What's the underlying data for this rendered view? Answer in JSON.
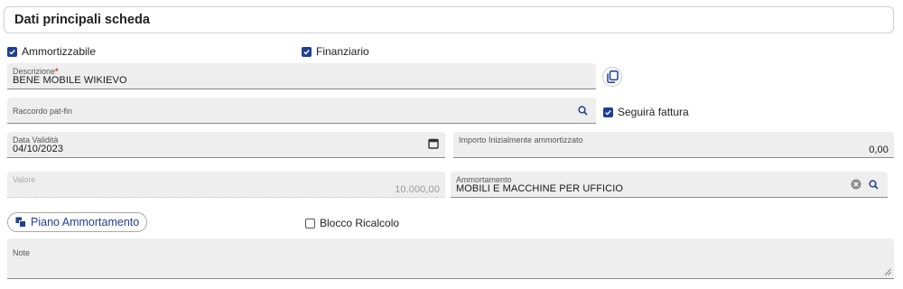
{
  "header": {
    "title": "Dati principali scheda"
  },
  "checkboxes": {
    "ammortizzabile": {
      "label": "Ammortizzabile",
      "checked": true
    },
    "finanziario": {
      "label": "Finanziario",
      "checked": true
    },
    "seguira_fattura": {
      "label": "Seguirà fattura",
      "checked": true
    },
    "blocco_ricalcolo": {
      "label": "Blocco Ricalcolo",
      "checked": false
    }
  },
  "fields": {
    "descrizione": {
      "label": "Descrizione",
      "required_mark": "*",
      "value": "BENE MOBILE WIKIEVO"
    },
    "raccordo": {
      "label": "Raccordo pat-fin",
      "value": ""
    },
    "data_validita": {
      "label": "Data Validità",
      "value": "04/10/2023"
    },
    "importo": {
      "label": "Importo Inizialmente ammortizzato",
      "value": "0,00"
    },
    "valore": {
      "label": "Valore",
      "value": "10.000,00"
    },
    "ammortamento": {
      "label": "Ammortamento",
      "value": "MOBILI E MACCHINE PER UFFICIO"
    },
    "note": {
      "label": "Note",
      "value": ""
    }
  },
  "buttons": {
    "piano_ammortamento": "Piano Ammortamento"
  },
  "icons": {
    "copy": "copy-icon",
    "search": "search-icon",
    "calendar": "calendar-icon",
    "clear": "clear-icon",
    "schedule": "schedule-icon",
    "resize": "resize-grip-icon"
  },
  "colors": {
    "accent": "#1f3f95",
    "required": "#d32f2f",
    "field_bg": "#eeeeee"
  }
}
